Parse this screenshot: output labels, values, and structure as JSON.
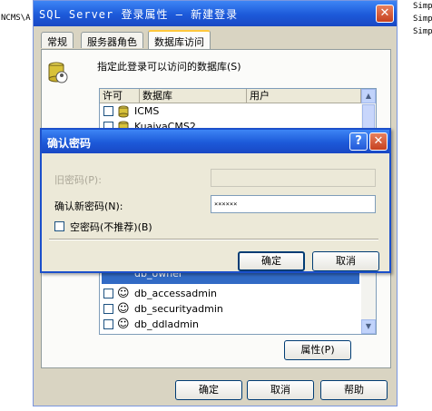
{
  "background_app": {
    "left_text": "NCMS\\A",
    "right_lines": [
      "Simp",
      "Simp",
      "Simp"
    ]
  },
  "login_window": {
    "title": "SQL Server 登录属性 — 新建登录",
    "tabs": [
      {
        "label": "常规",
        "active": false
      },
      {
        "label": "服务器角色",
        "active": false
      },
      {
        "label": "数据库访问",
        "active": true
      }
    ],
    "db_access_label": "指定此登录可以访问的数据库(S)",
    "db_grid": {
      "columns": [
        "许可",
        "数据库",
        "用户"
      ],
      "rows": [
        {
          "checked": false,
          "database": "ICMS",
          "user": ""
        },
        {
          "checked": false,
          "database": "KuaiyaCMS2",
          "user": ""
        }
      ]
    },
    "role_list": {
      "rows": [
        {
          "checked": false,
          "role": "db_owner"
        },
        {
          "checked": false,
          "role": "db_accessadmin"
        },
        {
          "checked": false,
          "role": "db_securityadmin"
        },
        {
          "checked": false,
          "role": "db_ddladmin"
        }
      ]
    },
    "properties_button": "属性(P)",
    "ok_button": "确定",
    "cancel_button": "取消",
    "help_button": "帮助"
  },
  "confirm_password_dialog": {
    "title": "确认密码",
    "old_password_label": "旧密码(P):",
    "old_password_value": "",
    "new_password_label": "确认新密码(N):",
    "new_password_value": "××××××",
    "blank_password_label": "空密码(不推荐)(B)",
    "blank_password_checked": false,
    "ok_button": "确定",
    "cancel_button": "取消"
  },
  "colors": {
    "titlebar": "#1c59d9",
    "dialog_face": "#ece9d8",
    "close_button": "#c6411f"
  }
}
